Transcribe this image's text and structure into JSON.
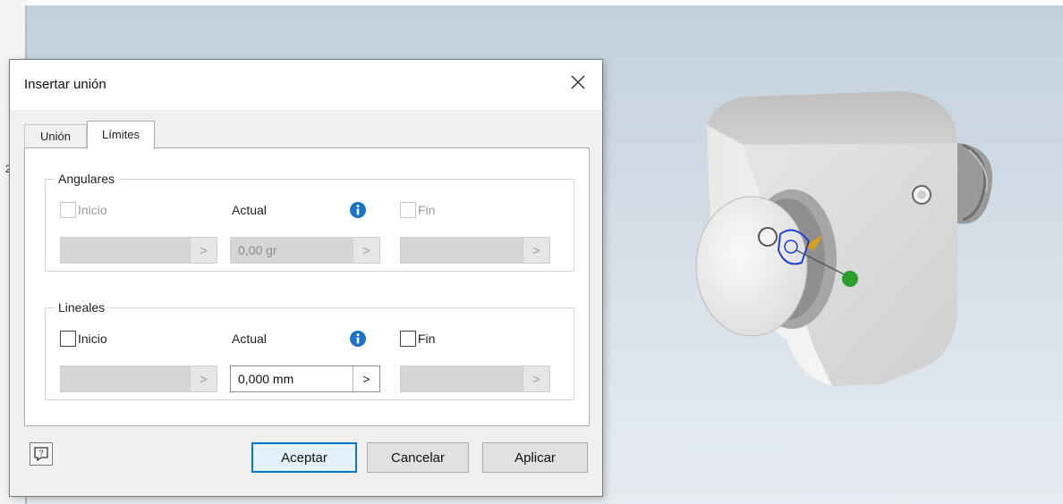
{
  "left_strip": {
    "marker": "2"
  },
  "dialog": {
    "title": "Insertar unión",
    "tabs": [
      {
        "label": "Unión"
      },
      {
        "label": "Límites"
      }
    ],
    "active_tab": "Límites",
    "angular": {
      "title": "Angulares",
      "start_label": "Inicio",
      "current_label": "Actual",
      "end_label": "Fin",
      "start_value": "",
      "current_value": "0,00 gr",
      "end_value": ""
    },
    "linear": {
      "title": "Lineales",
      "start_label": "Inicio",
      "current_label": "Actual",
      "end_label": "Fin",
      "start_value": "",
      "current_value": "0,000 mm",
      "end_value": ""
    },
    "buttons": {
      "ok": "Aceptar",
      "cancel": "Cancelar",
      "apply": "Aplicar"
    },
    "arrow_glyph": ">"
  },
  "colors": {
    "accent": "#0078d7",
    "info": "#1a73c8",
    "model_face": "#d9d9d9",
    "triad_x": "#2a9d2a",
    "triad_z": "#d8a020",
    "triad_glyph": "#1f3fd1"
  }
}
